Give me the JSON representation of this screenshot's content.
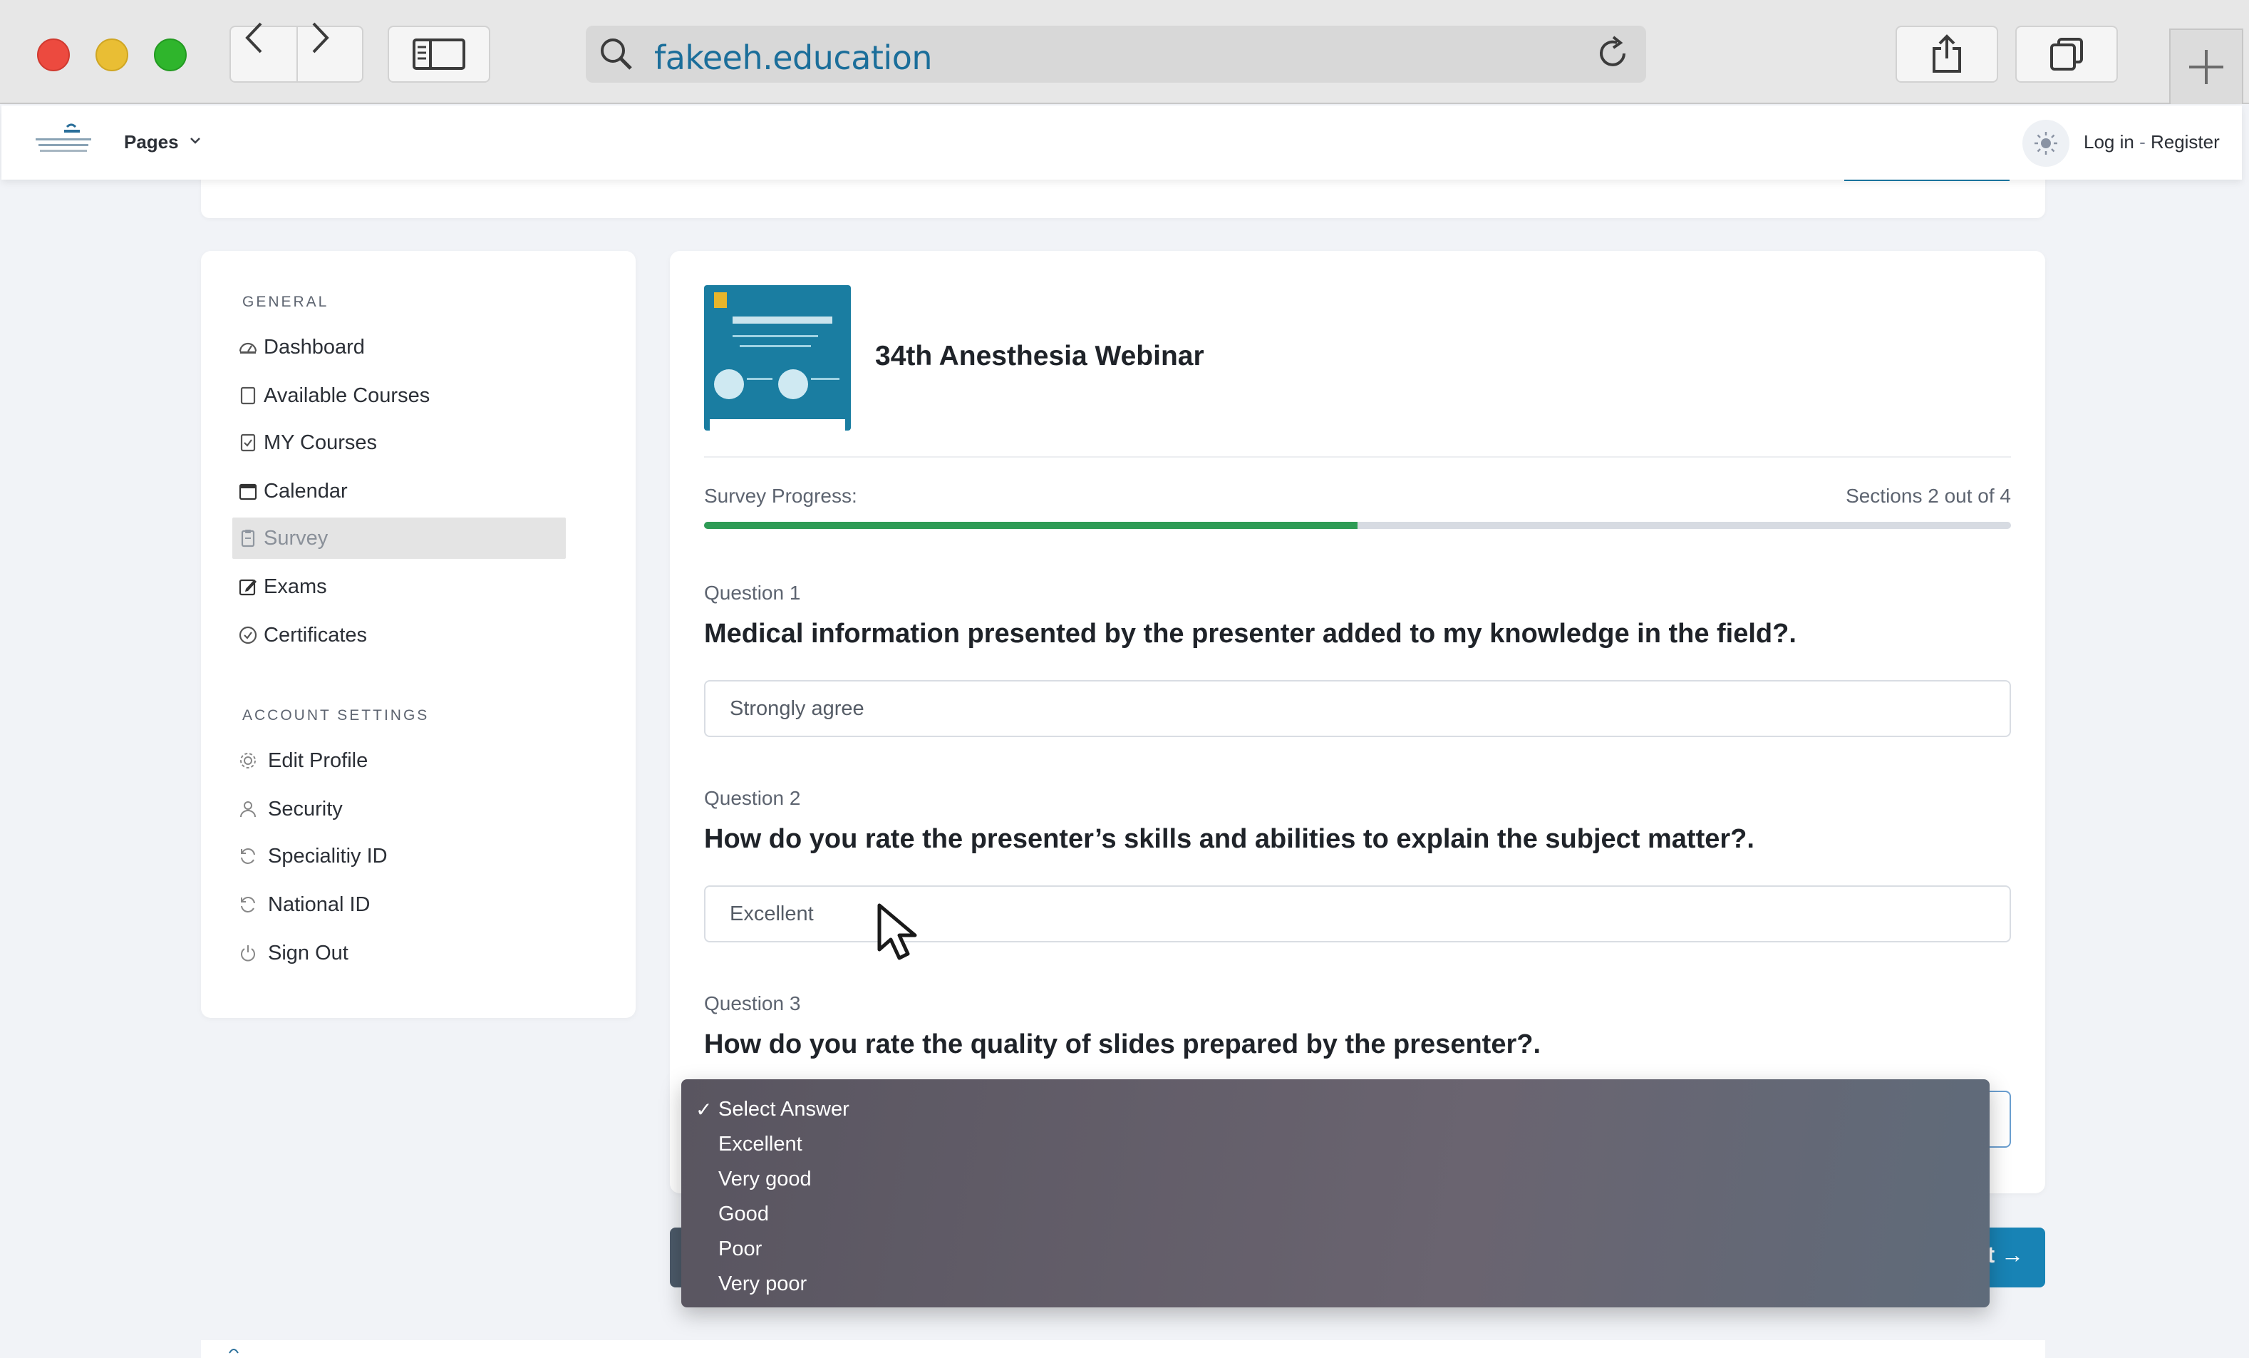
{
  "browser": {
    "url": "fakeeh.education"
  },
  "header": {
    "pages_label": "Pages",
    "auth_login": "Log in",
    "auth_sep": " - ",
    "auth_register": "Register"
  },
  "sidebar": {
    "general_title": "GENERAL",
    "general_items": [
      {
        "label": "Dashboard",
        "icon": "dashboard-icon"
      },
      {
        "label": "Available Courses",
        "icon": "book-icon"
      },
      {
        "label": "MY Courses",
        "icon": "checklist-icon"
      },
      {
        "label": "Calendar",
        "icon": "calendar-icon"
      },
      {
        "label": "Survey",
        "icon": "clipboard-icon",
        "active": true
      },
      {
        "label": "Exams",
        "icon": "edit-icon"
      },
      {
        "label": "Certificates",
        "icon": "check-circle-icon"
      }
    ],
    "account_title": "ACCOUNT SETTINGS",
    "account_items": [
      {
        "label": "Edit Profile",
        "icon": "gear-icon"
      },
      {
        "label": "Security",
        "icon": "user-icon"
      },
      {
        "label": "Specialitiy ID",
        "icon": "refresh-icon"
      },
      {
        "label": "National ID",
        "icon": "refresh-icon"
      },
      {
        "label": "Sign Out",
        "icon": "power-icon"
      }
    ]
  },
  "course": {
    "title": "34th Anesthesia Webinar"
  },
  "survey": {
    "progress_label": "Survey Progress:",
    "sections_text": "Sections 2 out of 4",
    "progress_fraction": 0.5,
    "questions": [
      {
        "label": "Question 1",
        "text": "Medical information presented by the presenter added to my knowledge in the field?.",
        "answer": "Strongly agree"
      },
      {
        "label": "Question 2",
        "text": "How do you rate the presenter’s skills and abilities to explain the subject matter?.",
        "answer": "Excellent"
      },
      {
        "label": "Question 3",
        "text": "How do you rate the quality of slides prepared by the presenter?.",
        "answer": ""
      }
    ]
  },
  "dropdown": {
    "options": [
      "Select Answer",
      "Excellent",
      "Very good",
      "Good",
      "Poor",
      "Very poor"
    ],
    "selected_index": 0,
    "check_glyph": "✓"
  },
  "buttons": {
    "next_partial": "t →"
  },
  "colors": {
    "progress_fill": "#2e9b55",
    "accent": "#1883b5",
    "link": "#1b6e9a"
  }
}
